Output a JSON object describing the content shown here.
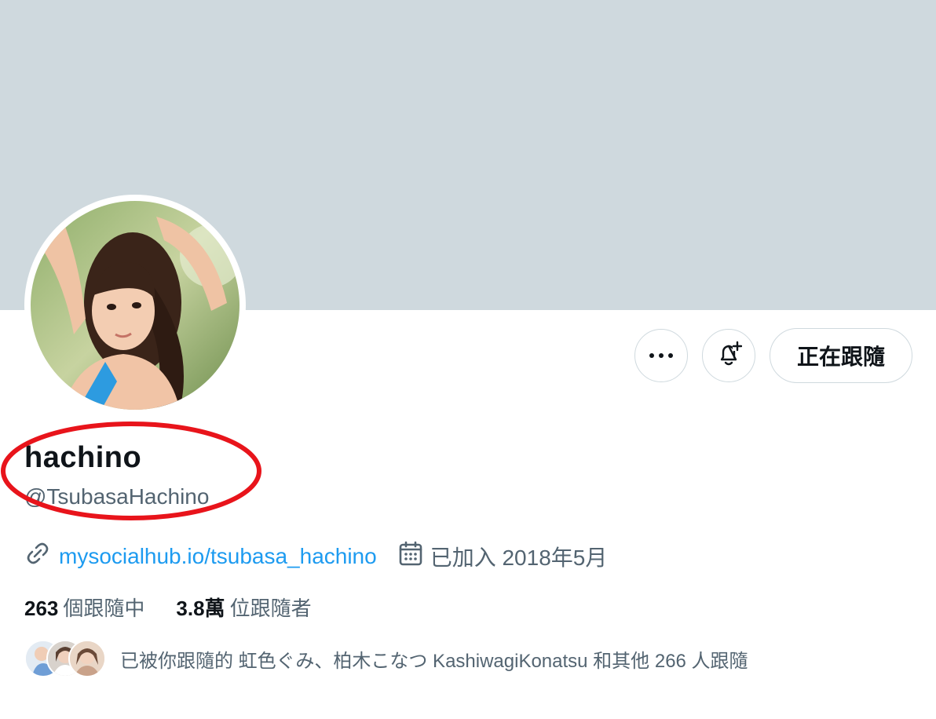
{
  "profile": {
    "display_name": "hachino",
    "handle": "@TsubasaHachino",
    "website": "mysocialhub.io/tsubasa_hachino",
    "joined": "已加入 2018年5月"
  },
  "actions": {
    "more_icon": "more-horizontal-icon",
    "notify_icon": "bell-plus-icon",
    "follow_label": "正在跟隨"
  },
  "stats": {
    "following_count": "263",
    "following_label": "個跟隨中",
    "followers_count": "3.8萬",
    "followers_label": "位跟隨者"
  },
  "known_followers": {
    "text": "已被你跟隨的 虹色ぐみ、柏木こなつ KashiwagiKonatsu 和其他 266 人跟隨"
  },
  "colors": {
    "banner": "#cfd9de",
    "link": "#1d9bf0",
    "secondary_text": "#536471",
    "annotation": "#e8141b"
  }
}
